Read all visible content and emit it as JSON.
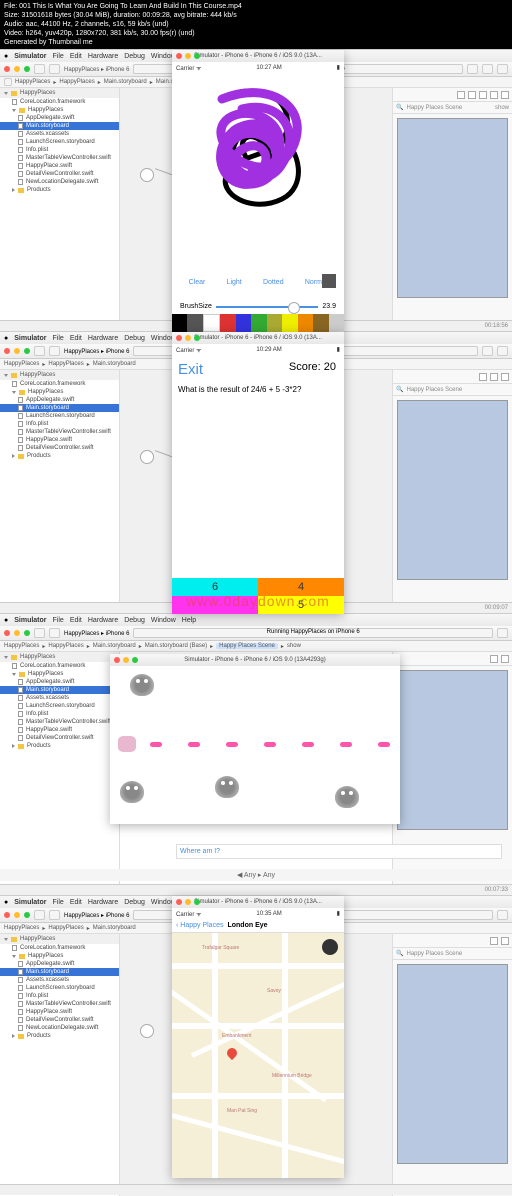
{
  "meta": {
    "l1": "File: 001 This Is What You Are Going To Learn And Build In This Course.mp4",
    "l2": "Size: 31501618 bytes (30.04 MiB), duration: 00:09:28, avg bitrate: 444 kb/s",
    "l3": "Audio: aac, 44100 Hz, 2 channels, s16, 59 kb/s (und)",
    "l4": "Video: h264, yuv420p, 1280x720, 381 kb/s, 30.00 fps(r) (und)",
    "l5": "Generated by Thumbnail me"
  },
  "menu": {
    "app": "Simulator",
    "items": [
      "File",
      "Edit",
      "Hardware",
      "Debug",
      "Window",
      "Help"
    ]
  },
  "sim_title": "Simulator - iPhone 6 - iPhone 6 / iOS 9.0 (13A...",
  "sim_title_full": "Simulator - iPhone 6 - iPhone 6 / iOS 9.0 (13A4293g)",
  "status": {
    "carrier": "Carrier",
    "wifi": "⚏"
  },
  "times": [
    "10:27 AM",
    "10:29 AM",
    "",
    "10:35 AM"
  ],
  "breadcrumb": {
    "project": "HappyPlaces",
    "device": "iPhone 6",
    "running": "Running HappyPlaces on iPhone 6"
  },
  "path": {
    "p1": "HappyPlaces",
    "p2": "HappyPlaces",
    "p3": "Main.storyboard",
    "p4": "Main.storyboard (Base)",
    "p5": "Happy Places Scene",
    "p6": "show"
  },
  "inspector": {
    "search": "Happy Places Scene",
    "show": "show"
  },
  "sidebar": {
    "root": "HappyPlaces",
    "items": [
      "CoreLocation.framework",
      "HappyPlaces",
      "AppDelegate.swift",
      "Main.storyboard",
      "Assets.xcassets",
      "LaunchScreen.storyboard",
      "Info.plist",
      "MasterTableViewController.swift",
      "HappyPlace.swift",
      "DetailViewController.swift",
      "NewLocationDelegate.swift",
      "Products"
    ]
  },
  "paint": {
    "opts": [
      "Clear",
      "Light",
      "Dotted",
      "Normal"
    ],
    "brush_label": "BrushSize",
    "brush_val": "23.9",
    "colors": [
      "#000",
      "#555",
      "#fff",
      "#d33",
      "#33d",
      "#3a3",
      "#aa3",
      "#ee0",
      "#e80",
      "#862",
      "#ccc"
    ]
  },
  "quiz": {
    "exit": "Exit",
    "score_label": "Score:",
    "score_val": "20",
    "question": "What is the result of 24/6 + 5 -3*2?",
    "answers": {
      "a": "6",
      "b": "4",
      "c": "5"
    },
    "watermark": "www.0daydown.com"
  },
  "game": {
    "where": "Where am I?",
    "filter": "Any ▸ Any"
  },
  "map": {
    "back": "Happy Places",
    "title": "London Eye",
    "poi": [
      "Trafalgar Square",
      "Savoy",
      "Embankment",
      "Millennium Bridge",
      "Man Pat Sing"
    ]
  },
  "timestamps": [
    "00:18:56",
    "00:09:07",
    "00:07:33",
    ""
  ]
}
